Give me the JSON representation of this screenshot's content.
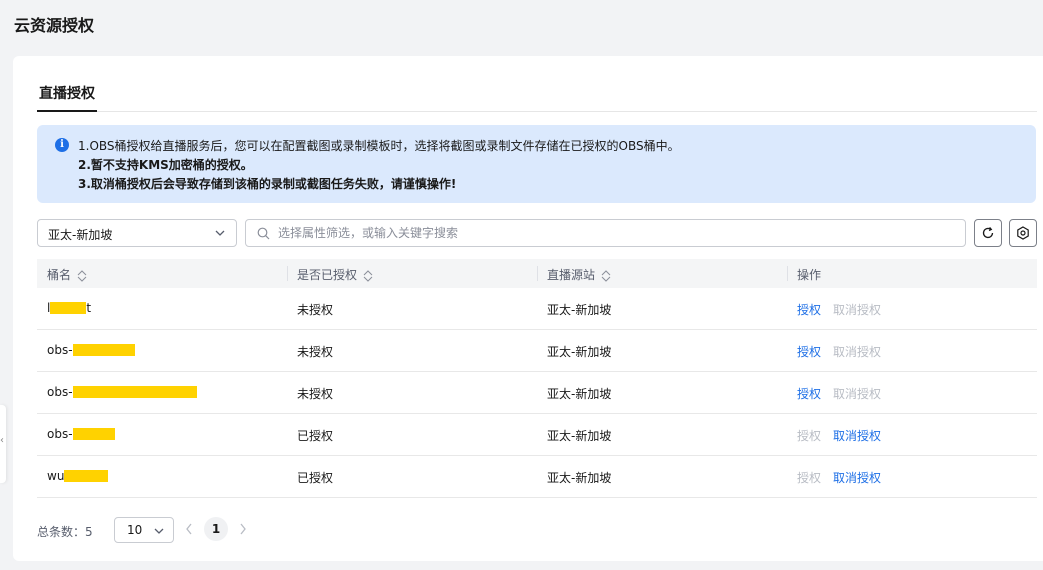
{
  "page_title": "云资源授权",
  "tabs": [
    {
      "label": "直播授权"
    }
  ],
  "notice": {
    "line1": "1.OBS桶授权给直播服务后，您可以在配置截图或录制模板时，选择将截图或录制文件存储在已授权的OBS桶中。",
    "line2": "2.暂不支持KMS加密桶的授权。",
    "line3": "3.取消桶授权后会导致存储到该桶的录制或截图任务失败，请谨慎操作!",
    "icon": "info-icon",
    "bg_color": "#dbe9fd"
  },
  "filters": {
    "region": "亚太-新加坡",
    "search_placeholder": "选择属性筛选，或输入关键字搜索"
  },
  "table": {
    "headers": [
      "桶名",
      "是否已授权",
      "直播源站",
      "操作"
    ],
    "rows": [
      {
        "name_prefix": "l",
        "name_suffix": "t",
        "mask_w": 36,
        "auth": "未授权",
        "site": "亚太-新加坡",
        "op1": "授权",
        "op2": "取消授权",
        "op1_enabled": true,
        "op2_enabled": false
      },
      {
        "name_prefix": "obs-",
        "name_suffix": "",
        "mask_w": 62,
        "auth": "未授权",
        "site": "亚太-新加坡",
        "op1": "授权",
        "op2": "取消授权",
        "op1_enabled": true,
        "op2_enabled": false
      },
      {
        "name_prefix": "obs-",
        "name_suffix": "",
        "mask_w": 124,
        "auth": "未授权",
        "site": "亚太-新加坡",
        "op1": "授权",
        "op2": "取消授权",
        "op1_enabled": true,
        "op2_enabled": false
      },
      {
        "name_prefix": "obs-",
        "name_suffix": "",
        "mask_w": 42,
        "auth": "已授权",
        "site": "亚太-新加坡",
        "op1": "授权",
        "op2": "取消授权",
        "op1_enabled": false,
        "op2_enabled": true
      },
      {
        "name_prefix": "wu",
        "name_suffix": "",
        "mask_w": 44,
        "auth": "已授权",
        "site": "亚太-新加坡",
        "op1": "授权",
        "op2": "取消授权",
        "op1_enabled": false,
        "op2_enabled": true
      }
    ]
  },
  "pagination": {
    "total_label": "总条数：5",
    "page_size": "10",
    "current_page": "1"
  },
  "colors": {
    "link": "#1e6fe6",
    "disabled": "#b8bcc4",
    "mask": "#ffd200"
  }
}
